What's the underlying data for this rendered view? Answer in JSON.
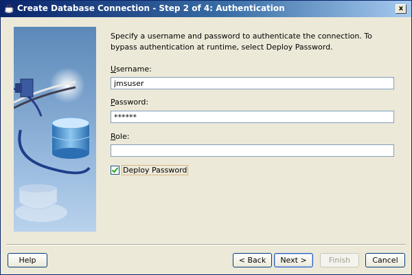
{
  "window": {
    "title": "Create Database Connection - Step 2 of 4: Authentication",
    "close_label": "x"
  },
  "instructions": "Specify a username and password to authenticate the connection. To bypass authentication at runtime, select Deploy Password.",
  "fields": {
    "username": {
      "label": "Username:",
      "value": "jmsuser"
    },
    "password": {
      "label": "Password:",
      "value": "******"
    },
    "role": {
      "label": "Role:",
      "value": ""
    }
  },
  "deploy_password": {
    "label": "Deploy Password",
    "checked": true
  },
  "buttons": {
    "help": "Help",
    "back": "< Back",
    "next": "Next >",
    "finish": "Finish",
    "cancel": "Cancel"
  },
  "icons": [
    "database-icon",
    "connector-plug-icon",
    "coffee-cup-icon",
    "close-icon"
  ],
  "colors": {
    "title_start": "#0a246a",
    "title_end": "#a6caf0",
    "window_bg": "#ece9d8"
  }
}
